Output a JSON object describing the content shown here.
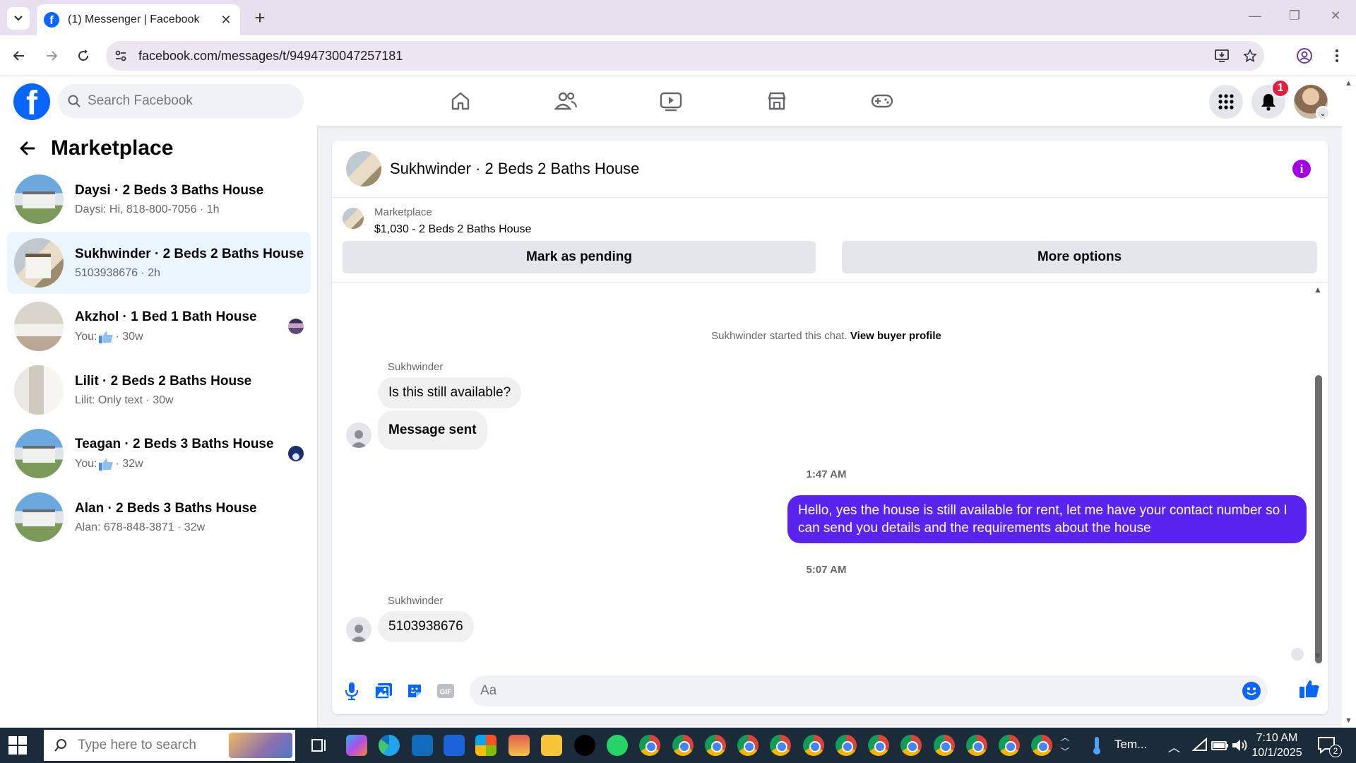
{
  "browser": {
    "tab_title": "(1) Messenger | Facebook",
    "url": "facebook.com/messages/t/9494730047257181"
  },
  "fb": {
    "logo": "f",
    "search_placeholder": "Search Facebook",
    "notification_count": "1",
    "brand_color": "#0866ff"
  },
  "sidebar": {
    "title": "Marketplace",
    "conversations": [
      {
        "name": "Daysi · 2 Beds 3 Baths House",
        "subtitle": "Daysi: Hi, 818-800-7056 · 1h"
      },
      {
        "name": "Sukhwinder · 2 Beds 2 Baths House",
        "subtitle": "5103938676 · 2h"
      },
      {
        "name": "Akzhol · 1 Bed 1 Bath House",
        "subtitle": "You: ",
        "time": "· 30w"
      },
      {
        "name": "Lilit · 2 Beds 2 Baths House",
        "subtitle": "Lilit: Only text · 30w"
      },
      {
        "name": "Teagan · 2 Beds 3 Baths House",
        "subtitle": "You: ",
        "time": "· 32w"
      },
      {
        "name": "Alan · 2 Beds 3 Baths House",
        "subtitle": "Alan: 678-848-3871 · 32w"
      }
    ]
  },
  "chat": {
    "title": "Sukhwinder · 2 Beds 2 Baths House",
    "listing_source": "Marketplace",
    "listing_price": "$1,030 - 2 Beds 2 Baths House",
    "mark_pending": "Mark as pending",
    "more_options": "More options",
    "started_text": "Sukhwinder started this chat.",
    "view_profile": "View buyer profile",
    "sender_name": "Sukhwinder",
    "msg1": "Is this still available?",
    "msg2": "Message sent",
    "time1": "1:47 AM",
    "outgoing": "Hello, yes the house is still available for rent, let me have your contact number so I can send you details and the requirements about the house",
    "time2": "5:07 AM",
    "msg3": "5103938676",
    "composer_placeholder": "Aa",
    "outgoing_color": "#5a24f0"
  },
  "taskbar": {
    "search_placeholder": "Type here to search",
    "weather": "Tem...",
    "time": "7:10 AM",
    "date": "10/1/2025",
    "notif_count": "2"
  }
}
